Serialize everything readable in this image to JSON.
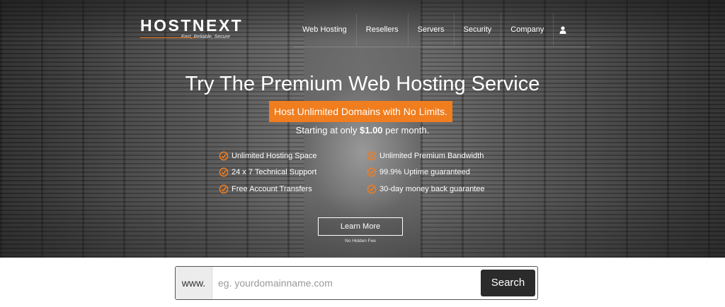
{
  "brand": {
    "logo_text": "HOSTNEXT",
    "tagline": "Fast, Reliable, Secure",
    "accent_color": "#f07d1e"
  },
  "nav": {
    "items": [
      {
        "label": "Web Hosting"
      },
      {
        "label": "Resellers"
      },
      {
        "label": "Servers"
      },
      {
        "label": "Security"
      },
      {
        "label": "Company"
      }
    ],
    "user_icon": "user-icon"
  },
  "hero": {
    "headline": "Try The Premium Web Hosting Service",
    "promo": "Host Unlimited Domains with No Limits.",
    "price_prefix": "Starting at only ",
    "price": "$1.00",
    "price_suffix": " per month.",
    "features_left": [
      "Unlimited Hosting Space",
      "24 x 7 Technical Support",
      "Free Account Transfers"
    ],
    "features_right": [
      "Unlimited Premium Bandwidth",
      "99.9% Uptime guaranteed",
      "30-day money back guarantee"
    ],
    "check_icon": "check-circle-icon",
    "cta_label": "Learn More",
    "cta_note": "No Hidden Fee"
  },
  "domain_search": {
    "prefix": "www.",
    "placeholder": "eg. yourdomainname.com",
    "value": "",
    "button_label": "Search"
  }
}
